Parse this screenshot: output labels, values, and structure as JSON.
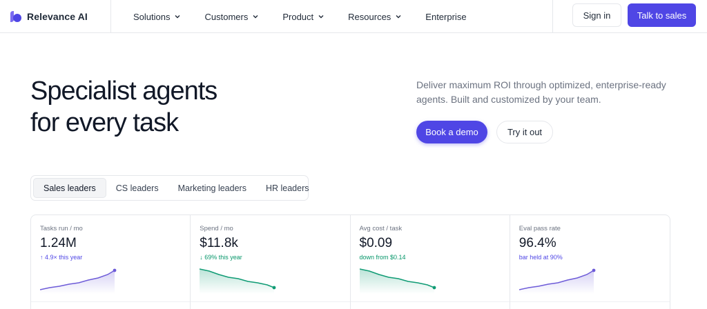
{
  "brand": {
    "name": "Relevance AI",
    "accent": "#4f46e5",
    "accent_light": "#a5b4fc"
  },
  "nav": {
    "items": [
      {
        "label": "Solutions",
        "dropdown": true
      },
      {
        "label": "Customers",
        "dropdown": true
      },
      {
        "label": "Product",
        "dropdown": true
      },
      {
        "label": "Resources",
        "dropdown": true
      },
      {
        "label": "Enterprise",
        "dropdown": false
      }
    ],
    "sign_in": "Sign in",
    "talk_to_sales": "Talk to sales"
  },
  "hero": {
    "title_line1": "Specialist agents",
    "title_line2": "for every task",
    "subtitle": "Deliver maximum ROI through optimized, enterprise-ready agents. Built and customized by your team.",
    "primary_cta": "Book a demo",
    "secondary_cta": "Try it out"
  },
  "tabs": {
    "items": [
      "Sales leaders",
      "CS leaders",
      "Marketing leaders",
      "HR leaders"
    ],
    "active": "Sales leaders"
  },
  "metrics": [
    {
      "label": "Tasks run / mo",
      "value": "1.24M",
      "delta": "↑ 4.9× this year",
      "delta_color": "#4f46e5",
      "trend": "up",
      "spark_color": "#6d5bd8"
    },
    {
      "label": "Spend / mo",
      "value": "$11.8k",
      "delta": "↓ 69% this year",
      "delta_color": "#059669",
      "trend": "down",
      "spark_color": "#0f9b74"
    },
    {
      "label": "Avg cost / task",
      "value": "$0.09",
      "delta": "down from $0.14",
      "delta_color": "#059669",
      "trend": "down",
      "spark_color": "#0f9b74"
    },
    {
      "label": "Eval pass rate",
      "value": "96.4%",
      "delta": "bar held at 90%",
      "delta_color": "#4f46e5",
      "trend": "up",
      "spark_color": "#6d5bd8"
    }
  ]
}
